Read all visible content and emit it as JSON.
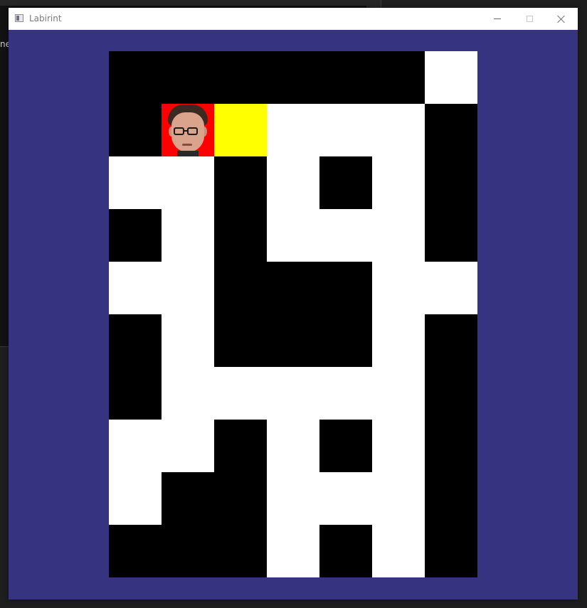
{
  "background_window": {
    "text_fragment": "ne"
  },
  "window": {
    "title": "Labirint",
    "icon": "app-window-icon",
    "controls": [
      "minimize-icon",
      "maximize-icon",
      "close-icon"
    ]
  },
  "colors": {
    "window_background": "#363480",
    "wall": "#000000",
    "path": "#ffffff",
    "player": "#ff0000",
    "goal": "#ffff00"
  },
  "maze": {
    "columns": 7,
    "rows": 10,
    "legend": {
      "W": "wall",
      "P": "path",
      "S": "player",
      "G": "goal"
    },
    "grid": [
      [
        "W",
        "W",
        "W",
        "W",
        "W",
        "W",
        "P"
      ],
      [
        "W",
        "S",
        "G",
        "P",
        "P",
        "P",
        "W"
      ],
      [
        "P",
        "P",
        "W",
        "P",
        "W",
        "P",
        "W"
      ],
      [
        "W",
        "P",
        "W",
        "P",
        "P",
        "P",
        "W"
      ],
      [
        "P",
        "P",
        "W",
        "W",
        "W",
        "P",
        "P"
      ],
      [
        "W",
        "P",
        "W",
        "W",
        "W",
        "P",
        "W"
      ],
      [
        "W",
        "P",
        "P",
        "P",
        "P",
        "P",
        "W"
      ],
      [
        "P",
        "P",
        "W",
        "P",
        "W",
        "P",
        "W"
      ],
      [
        "P",
        "W",
        "W",
        "P",
        "P",
        "P",
        "W"
      ],
      [
        "W",
        "W",
        "W",
        "P",
        "W",
        "P",
        "W"
      ]
    ],
    "player_icon": "player-face-icon"
  }
}
